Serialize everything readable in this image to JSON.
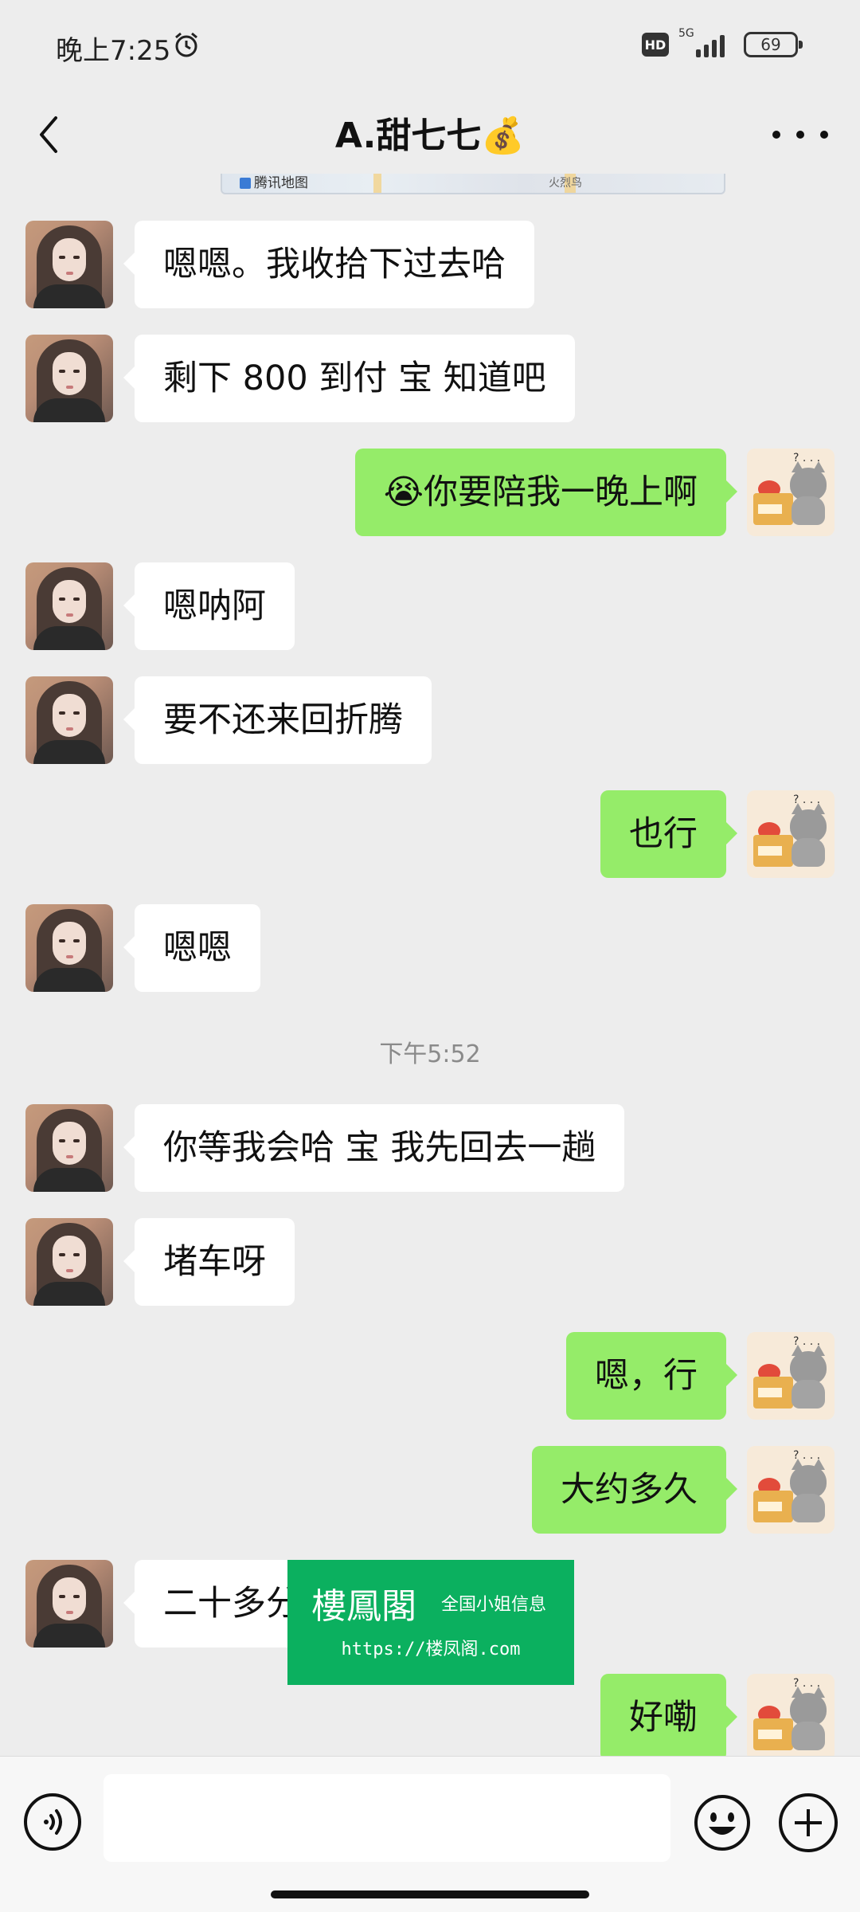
{
  "status_bar": {
    "time": "晚上7:25",
    "hd": "HD",
    "network": "5G",
    "battery": "69"
  },
  "nav": {
    "title": "A.甜七七💰"
  },
  "map_preview": {
    "label": "腾讯地图",
    "poi": "火烈鸟"
  },
  "messages": [
    {
      "side": "left",
      "text": "嗯嗯。我收拾下过去哈"
    },
    {
      "side": "left",
      "text": "剩下 800 到付 宝 知道吧"
    },
    {
      "side": "right",
      "text": "😭你要陪我一晚上啊"
    },
    {
      "side": "left",
      "text": "嗯呐阿"
    },
    {
      "side": "left",
      "text": "要不还来回折腾"
    },
    {
      "side": "right",
      "text": "也行"
    },
    {
      "side": "left",
      "text": "嗯嗯"
    },
    {
      "side": "left",
      "text": "你等我会哈 宝 我先回去一趟"
    },
    {
      "side": "left",
      "text": "堵车呀"
    },
    {
      "side": "right",
      "text": "嗯，行"
    },
    {
      "side": "right",
      "text": "大约多久"
    },
    {
      "side": "left",
      "text": "二十多分钟"
    },
    {
      "side": "right",
      "text": "好嘞"
    }
  ],
  "time_separator": "下午5:52",
  "watermark": {
    "title": "樓鳳閣",
    "subtitle": "全国小姐信息",
    "url": "https://楼凤阁.com"
  },
  "input": {
    "value": ""
  }
}
